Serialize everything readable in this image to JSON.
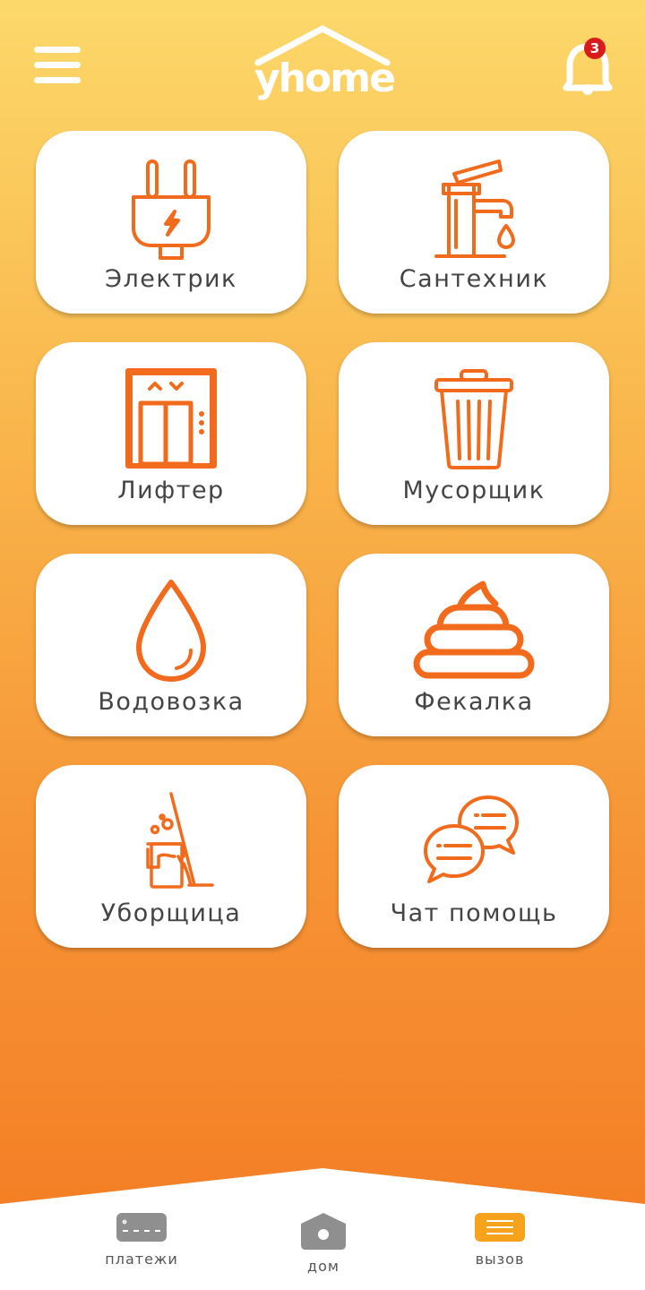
{
  "app": {
    "logo_text": "yhome"
  },
  "header": {
    "notification_count": "3"
  },
  "services": [
    {
      "label": "Электрик",
      "icon": "plug-icon"
    },
    {
      "label": "Сантехник",
      "icon": "faucet-icon"
    },
    {
      "label": "Лифтер",
      "icon": "elevator-icon"
    },
    {
      "label": "Мусорщик",
      "icon": "trash-can-icon"
    },
    {
      "label": "Водовозка",
      "icon": "water-drop-icon"
    },
    {
      "label": "Фекалка",
      "icon": "poop-icon"
    },
    {
      "label": "Уборщица",
      "icon": "mop-bucket-icon"
    },
    {
      "label": "Чат помощь",
      "icon": "chat-bubbles-icon"
    }
  ],
  "bottom_nav": [
    {
      "label": "платежи",
      "icon": "credit-card-icon",
      "active": false
    },
    {
      "label": "дом",
      "icon": "house-icon",
      "active": false
    },
    {
      "label": "вызов",
      "icon": "call-list-icon",
      "active": true
    }
  ],
  "colors": {
    "accent": "#f26a1b",
    "nav_icon": "#8f8f8f",
    "nav_active": "#f7a21b",
    "badge": "#d81b1b"
  }
}
